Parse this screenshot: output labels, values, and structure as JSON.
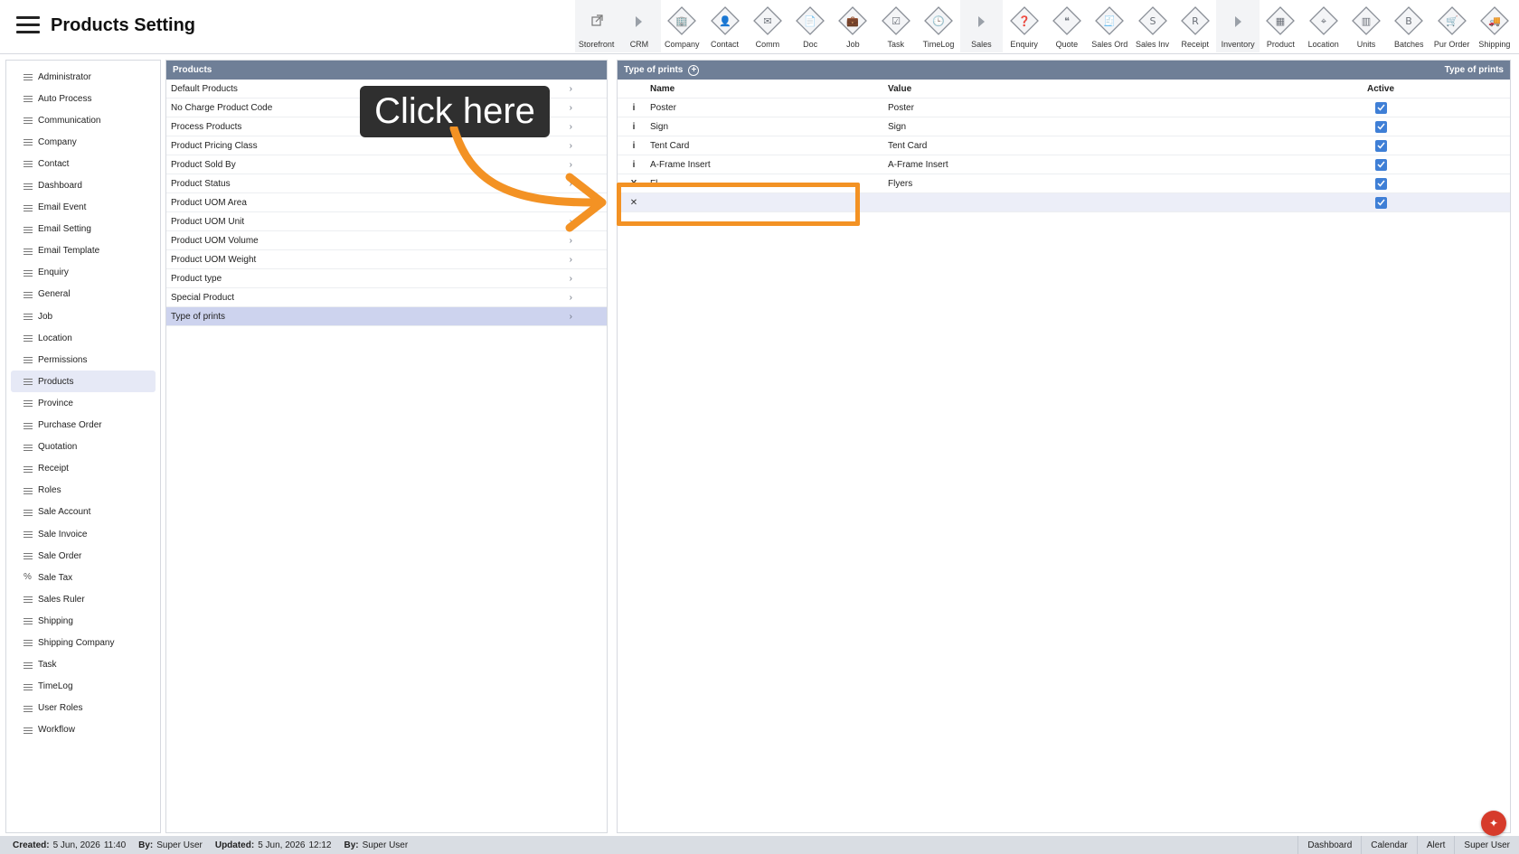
{
  "header": {
    "title": "Products Setting"
  },
  "toolbar": [
    {
      "label": "Storefront",
      "icon": "external-link-icon",
      "group": true
    },
    {
      "label": "CRM",
      "icon": "arrow-right-icon",
      "group": true
    },
    {
      "label": "Company",
      "icon": "company-icon",
      "group": false
    },
    {
      "label": "Contact",
      "icon": "contact-icon",
      "group": false
    },
    {
      "label": "Comm",
      "icon": "comm-icon",
      "group": false
    },
    {
      "label": "Doc",
      "icon": "doc-icon",
      "group": false
    },
    {
      "label": "Job",
      "icon": "job-icon",
      "group": false
    },
    {
      "label": "Task",
      "icon": "task-icon",
      "group": false
    },
    {
      "label": "TimeLog",
      "icon": "clock-icon",
      "group": false
    },
    {
      "label": "Sales",
      "icon": "arrow-right-icon",
      "group": true
    },
    {
      "label": "Enquiry",
      "icon": "enquiry-icon",
      "group": false
    },
    {
      "label": "Quote",
      "icon": "quote-icon",
      "group": false
    },
    {
      "label": "Sales Ord",
      "icon": "sales-order-icon",
      "group": false
    },
    {
      "label": "Sales Inv",
      "icon": "sales-invoice-icon",
      "group": false
    },
    {
      "label": "Receipt",
      "icon": "receipt-icon",
      "group": false
    },
    {
      "label": "Inventory",
      "icon": "arrow-right-icon",
      "group": true
    },
    {
      "label": "Product",
      "icon": "product-icon",
      "group": false
    },
    {
      "label": "Location",
      "icon": "location-icon",
      "group": false
    },
    {
      "label": "Units",
      "icon": "units-icon",
      "group": false
    },
    {
      "label": "Batches",
      "icon": "batches-icon",
      "group": false
    },
    {
      "label": "Pur Order",
      "icon": "cart-icon",
      "group": false
    },
    {
      "label": "Shipping",
      "icon": "truck-icon",
      "group": false
    }
  ],
  "sidebar": {
    "items": [
      {
        "label": "Administrator",
        "icon": "list-icon"
      },
      {
        "label": "Auto Process",
        "icon": "list-icon"
      },
      {
        "label": "Communication",
        "icon": "list-icon"
      },
      {
        "label": "Company",
        "icon": "list-icon"
      },
      {
        "label": "Contact",
        "icon": "list-icon"
      },
      {
        "label": "Dashboard",
        "icon": "list-icon"
      },
      {
        "label": "Email Event",
        "icon": "list-icon"
      },
      {
        "label": "Email Setting",
        "icon": "list-icon"
      },
      {
        "label": "Email Template",
        "icon": "list-icon"
      },
      {
        "label": "Enquiry",
        "icon": "list-icon"
      },
      {
        "label": "General",
        "icon": "list-icon"
      },
      {
        "label": "Job",
        "icon": "list-icon"
      },
      {
        "label": "Location",
        "icon": "list-icon"
      },
      {
        "label": "Permissions",
        "icon": "list-icon"
      },
      {
        "label": "Products",
        "icon": "list-icon",
        "active": true
      },
      {
        "label": "Province",
        "icon": "list-icon"
      },
      {
        "label": "Purchase Order",
        "icon": "list-icon"
      },
      {
        "label": "Quotation",
        "icon": "list-icon"
      },
      {
        "label": "Receipt",
        "icon": "list-icon"
      },
      {
        "label": "Roles",
        "icon": "list-icon"
      },
      {
        "label": "Sale Account",
        "icon": "list-icon"
      },
      {
        "label": "Sale Invoice",
        "icon": "list-icon"
      },
      {
        "label": "Sale Order",
        "icon": "list-icon"
      },
      {
        "label": "Sale Tax",
        "icon": "percent-icon"
      },
      {
        "label": "Sales Ruler",
        "icon": "list-icon"
      },
      {
        "label": "Shipping",
        "icon": "list-icon"
      },
      {
        "label": "Shipping Company",
        "icon": "list-icon"
      },
      {
        "label": "Task",
        "icon": "list-icon"
      },
      {
        "label": "TimeLog",
        "icon": "list-icon"
      },
      {
        "label": "User Roles",
        "icon": "list-icon"
      },
      {
        "label": "Workflow",
        "icon": "list-icon"
      }
    ]
  },
  "middle": {
    "title": "Products",
    "items": [
      {
        "label": "Default Products"
      },
      {
        "label": "No Charge Product Code"
      },
      {
        "label": "Process Products"
      },
      {
        "label": "Product Pricing Class"
      },
      {
        "label": "Product Sold By"
      },
      {
        "label": "Product Status"
      },
      {
        "label": "Product UOM Area"
      },
      {
        "label": "Product UOM Unit"
      },
      {
        "label": "Product UOM Volume"
      },
      {
        "label": "Product UOM Weight"
      },
      {
        "label": "Product type"
      },
      {
        "label": "Special Product"
      },
      {
        "label": "Type of prints",
        "active": true
      }
    ]
  },
  "right": {
    "title": "Type of prints",
    "title_right": "Type of prints",
    "columns": {
      "name": "Name",
      "value": "Value",
      "active": "Active"
    },
    "rows": [
      {
        "action": "i",
        "name": "Poster",
        "value": "Poster",
        "active": true
      },
      {
        "action": "i",
        "name": "Sign",
        "value": "Sign",
        "active": true
      },
      {
        "action": "i",
        "name": "Tent Card",
        "value": "Tent Card",
        "active": true
      },
      {
        "action": "i",
        "name": "A-Frame Insert",
        "value": "A-Frame Insert",
        "active": true
      },
      {
        "action": "X",
        "name": "Fl",
        "value": "Flyers",
        "active": true
      }
    ],
    "new_row": {
      "action": "✕",
      "name": "",
      "value": "",
      "active": true
    }
  },
  "status": {
    "created_label": "Created:",
    "created_date": "5 Jun, 2026",
    "created_time": "11:40",
    "created_by_label": "By:",
    "created_by": "Super User",
    "updated_label": "Updated:",
    "updated_date": "5 Jun, 2026",
    "updated_time": "12:12",
    "updated_by_label": "By:",
    "updated_by": "Super User",
    "links": [
      "Dashboard",
      "Calendar",
      "Alert",
      "Super User"
    ]
  },
  "annotation": {
    "callout_text": "Click here",
    "color": "#f39224"
  }
}
